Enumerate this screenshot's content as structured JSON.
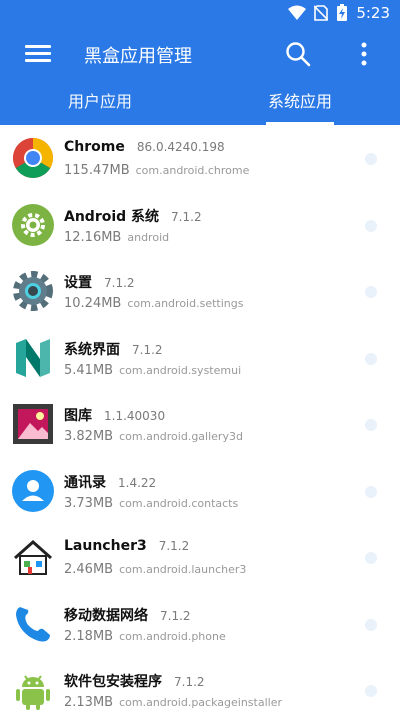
{
  "status": {
    "time": "5:23"
  },
  "toolbar": {
    "title": "黑盒应用管理"
  },
  "tabs": [
    {
      "label": "用户应用"
    },
    {
      "label": "系统应用"
    }
  ],
  "apps": [
    {
      "name": "Chrome",
      "version": "86.0.4240.198",
      "size": "115.47MB",
      "package": "com.android.chrome",
      "icon": "chrome-icon"
    },
    {
      "name": "Android 系统",
      "version": "7.1.2",
      "size": "12.16MB",
      "package": "android",
      "icon": "android-system-gear-icon"
    },
    {
      "name": "设置",
      "version": "7.1.2",
      "size": "10.24MB",
      "package": "com.android.settings",
      "icon": "settings-gear-icon"
    },
    {
      "name": "系统界面",
      "version": "7.1.2",
      "size": "5.41MB",
      "package": "com.android.systemui",
      "icon": "nougat-logo-icon"
    },
    {
      "name": "图库",
      "version": "1.1.40030",
      "size": "3.82MB",
      "package": "com.android.gallery3d",
      "icon": "gallery-icon"
    },
    {
      "name": "通讯录",
      "version": "1.4.22",
      "size": "3.73MB",
      "package": "com.android.contacts",
      "icon": "contacts-icon"
    },
    {
      "name": "Launcher3",
      "version": "7.1.2",
      "size": "2.46MB",
      "package": "com.android.launcher3",
      "icon": "home-icon"
    },
    {
      "name": "移动数据网络",
      "version": "7.1.2",
      "size": "2.18MB",
      "package": "com.android.phone",
      "icon": "phone-icon"
    },
    {
      "name": "软件包安装程序",
      "version": "7.1.2",
      "size": "2.13MB",
      "package": "com.android.packageinstaller",
      "icon": "android-robot-icon"
    }
  ],
  "colors": {
    "accent": "#2b79e6",
    "background": "#ffffff"
  }
}
